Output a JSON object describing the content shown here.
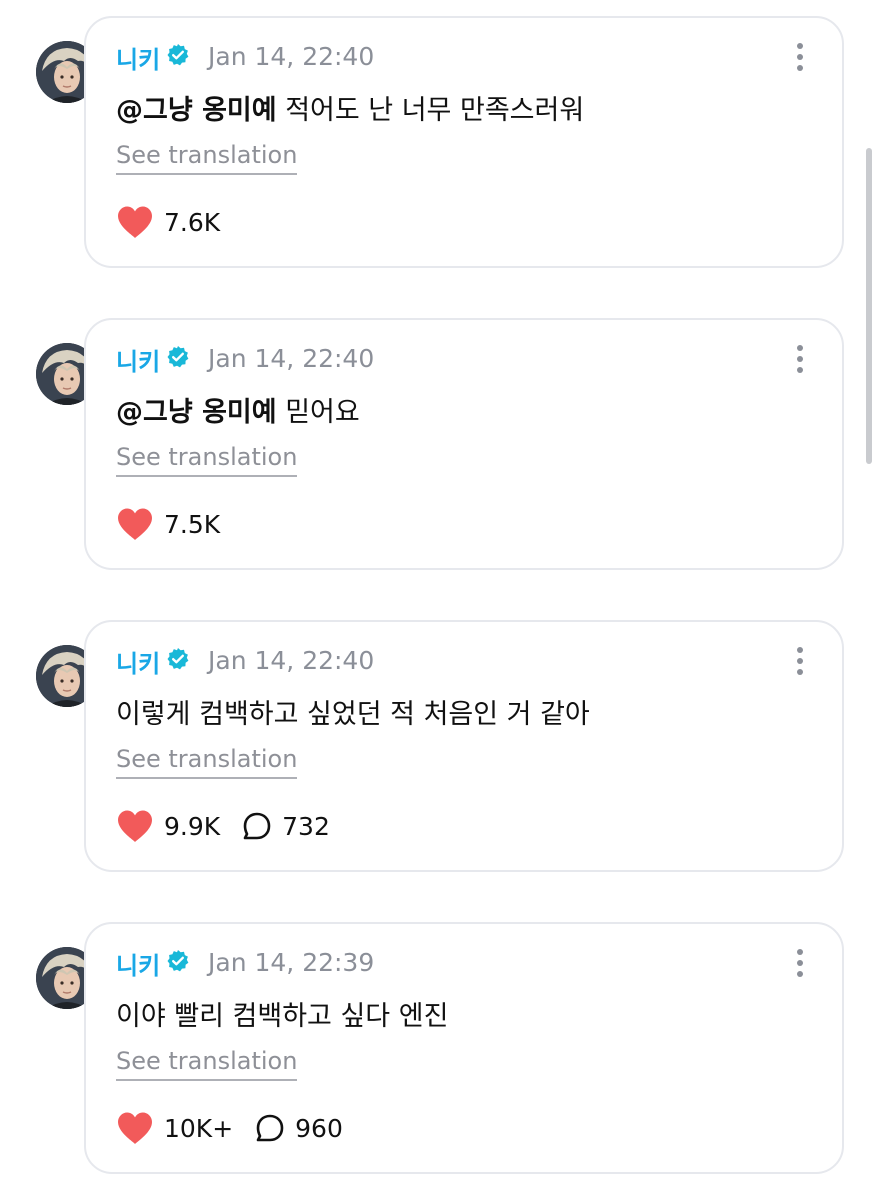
{
  "posts": [
    {
      "username": "니키",
      "timestamp": "Jan 14, 22:40",
      "mention": "@그냥 옹미예",
      "body": " 적어도 난 너무 만족스러워",
      "translate_label": "See translation",
      "likes": "7.6K",
      "comments": ""
    },
    {
      "username": "니키",
      "timestamp": "Jan 14, 22:40",
      "mention": "@그냥 옹미예",
      "body": " 믿어요",
      "translate_label": "See translation",
      "likes": "7.5K",
      "comments": ""
    },
    {
      "username": "니키",
      "timestamp": "Jan 14, 22:40",
      "mention": "",
      "body": "이렇게 컴백하고 싶었던 적 처음인 거 같아",
      "translate_label": "See translation",
      "likes": "9.9K",
      "comments": "732"
    },
    {
      "username": "니키",
      "timestamp": "Jan 14, 22:39",
      "mention": "",
      "body": "이야 빨리 컴백하고 싶다 엔진",
      "translate_label": "See translation",
      "likes": "10K+",
      "comments": "960"
    }
  ],
  "icons": {
    "verified": "verified-badge-icon",
    "more": "more-vertical-icon",
    "like": "heart-icon",
    "comment": "comment-bubble-icon"
  },
  "colors": {
    "username": "#19a7e6",
    "verified_badge": "#19b8d8",
    "heart": "#f25a5a",
    "timestamp": "#8b8f98",
    "card_border": "#e6e8ed"
  }
}
